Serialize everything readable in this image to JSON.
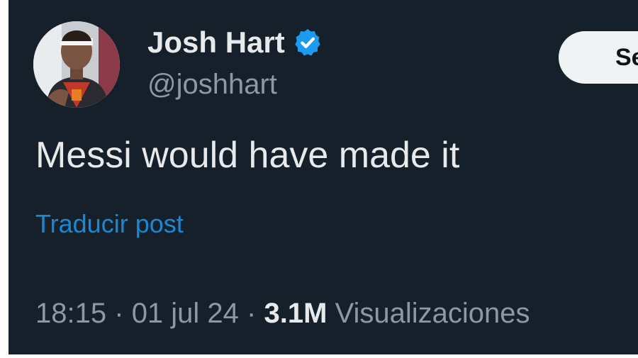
{
  "author": {
    "display_name": "Josh Hart",
    "handle": "@joshhart",
    "verified_icon": "verified-badge-icon",
    "badge_color": "#1d9bf0"
  },
  "actions": {
    "subscribe_label": "Se"
  },
  "post": {
    "text": "Messi would have made it",
    "translate_label": "Traducir post"
  },
  "meta": {
    "time": "18:15",
    "separator": "·",
    "date": "01 jul 24",
    "views_count": "3.1M",
    "views_label": "Visualizaciones"
  },
  "theme": {
    "background": "#15202b",
    "text_primary": "#e7e9ea",
    "text_secondary": "#8b98a5",
    "link": "#1d9bf0"
  }
}
